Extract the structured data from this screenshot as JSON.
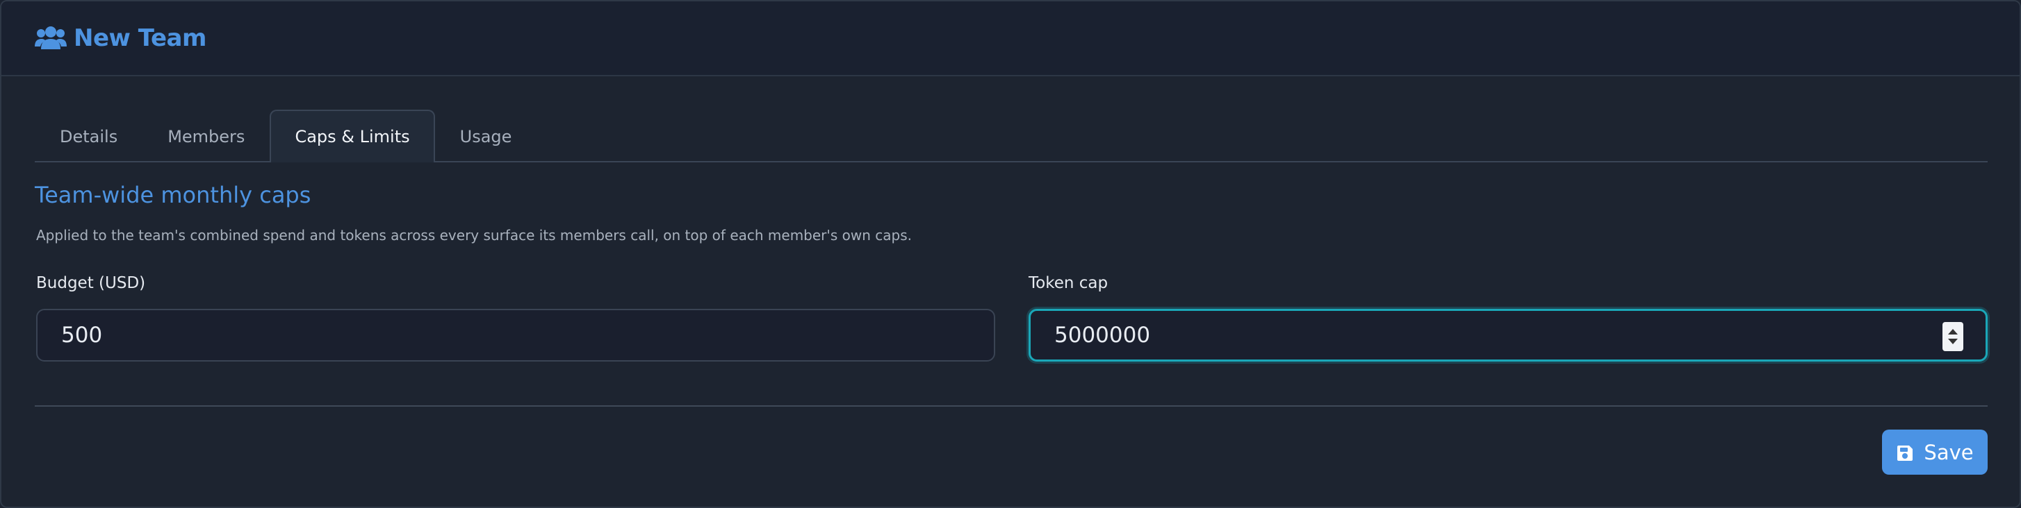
{
  "header": {
    "title": "New Team",
    "icon": "users-icon"
  },
  "tabs": [
    {
      "label": "Details",
      "active": false
    },
    {
      "label": "Members",
      "active": false
    },
    {
      "label": "Caps & Limits",
      "active": true
    },
    {
      "label": "Usage",
      "active": false
    }
  ],
  "section": {
    "title": "Team-wide monthly caps",
    "description": "Applied to the team's combined spend and tokens across every surface its members call, on top of each member's own caps."
  },
  "fields": {
    "budget": {
      "label": "Budget (USD)",
      "value": "500"
    },
    "token_cap": {
      "label": "Token cap",
      "value": "5000000"
    }
  },
  "actions": {
    "save_label": "Save",
    "save_icon": "floppy-disk-icon"
  },
  "colors": {
    "accent": "#4b93e4",
    "focus": "#1aa7b8",
    "background": "#1d2430"
  }
}
